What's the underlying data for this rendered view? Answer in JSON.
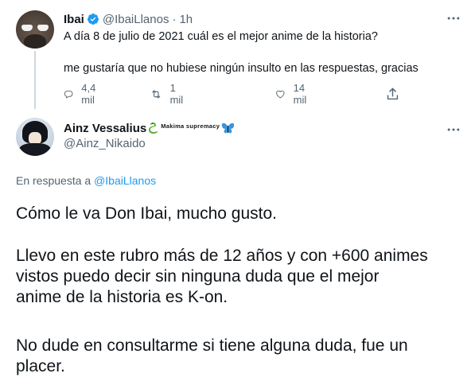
{
  "parent_tweet": {
    "display_name": "Ibai",
    "handle": "@IbaiLlanos",
    "separator": "·",
    "time": "1h",
    "text_line1": "A día 8 de julio de 2021 cuál es el mejor anime de la historia?",
    "text_line2": "me gustaría que no hubiese ningún insulto en las respuestas, gracias",
    "replies_count": "4,4 mil",
    "retweets_count": "1 mil",
    "likes_count": "14 mil",
    "icons": [
      "verified-badge",
      "reply-icon",
      "retweet-icon",
      "like-icon",
      "share-icon",
      "more-icon"
    ]
  },
  "reply_tweet": {
    "display_name": "Ainz Vessalius",
    "name_extra": "Makima supremacy",
    "handle": "@Ainz_Nikaido",
    "replying_prefix": "En respuesta a",
    "replying_handle": "@IbaiLlanos",
    "body": [
      "Cómo le va Don Ibai, mucho gusto.",
      "Llevo en este rubro más de 12 años y con +600 animes",
      "vistos puedo decir sin ninguna duda que el mejor",
      "anime de la historia es K-on.",
      "No dude en consultarme si tiene alguna duda, fue un",
      "placer."
    ],
    "icons": [
      "snake-emoji",
      "butterfly-emoji",
      "more-icon"
    ]
  },
  "colors": {
    "accent": "#1d9bf0",
    "muted": "#536471",
    "text": "#0f1419",
    "thread_line": "#cfd9de"
  }
}
